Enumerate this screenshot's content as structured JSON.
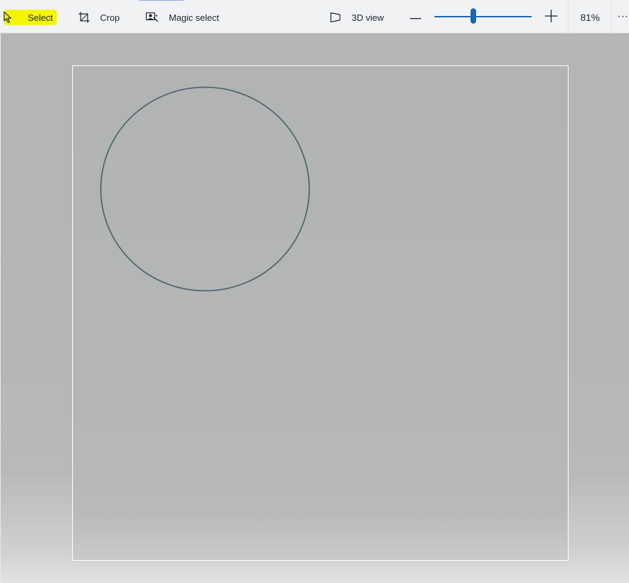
{
  "toolbar": {
    "select_label": "Select",
    "crop_label": "Crop",
    "magic_select_label": "Magic select",
    "view3d_label": "3D view",
    "zoom_minus_icon": "minus-icon",
    "zoom_plus_icon": "plus-icon",
    "zoom_level": 0.4,
    "zoom_value": "81%",
    "more_icon": "more-icon",
    "more_label": "···"
  },
  "icons": {
    "select": "cursor-arrow-icon",
    "crop": "crop-icon",
    "magic_select": "magic-select-icon",
    "view3d": "3d-view-icon"
  },
  "colors": {
    "highlight": "#f6f500",
    "accent": "#1b65b3",
    "shape_stroke": "#4d6670",
    "workspace": "#b4b6b5",
    "canvas_border": "#ffffff"
  },
  "canvas": {
    "shapes": [
      {
        "type": "ellipse",
        "name": "circle-shape"
      }
    ]
  }
}
